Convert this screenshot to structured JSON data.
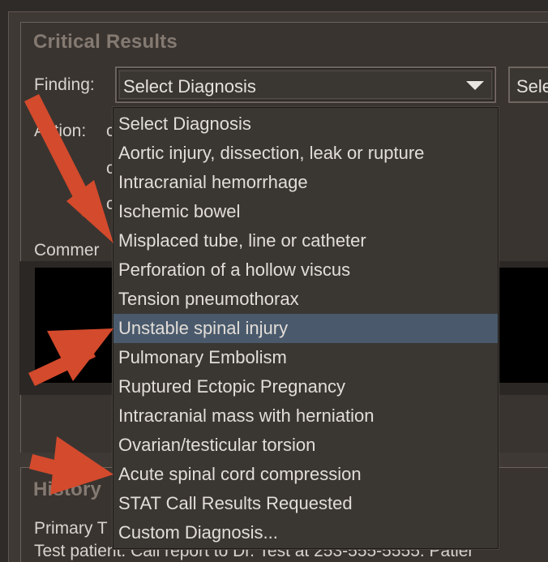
{
  "critical_results": {
    "title": "Critical Results",
    "finding_label": "Finding:",
    "finding_value": "Select Diagnosis",
    "second_select_value": "Sele",
    "action_label": "Action:",
    "action_stub_1": "c",
    "action_stub_2": "c",
    "action_stub_3": "c",
    "comment_label": "Commer"
  },
  "history": {
    "title": "History",
    "primary_label": "Primary T",
    "note": "Test patient. Call report to Dr. Test at 253-555-5555. Patier"
  },
  "dropdown": {
    "options": [
      "Select Diagnosis",
      "Aortic injury, dissection, leak or rupture",
      "Intracranial hemorrhage",
      "Ischemic bowel",
      "Misplaced tube, line or catheter",
      "Perforation of a hollow viscus",
      "Tension pneumothorax",
      "Unstable spinal injury",
      "Pulmonary Embolism",
      "Ruptured Ectopic Pregnancy",
      "Intracranial mass with herniation",
      "Ovarian/testicular torsion",
      "Acute spinal cord compression",
      "STAT Call Results Requested",
      "Custom Diagnosis..."
    ],
    "highlighted_option": "Unstable spinal injury"
  },
  "colors": {
    "annotation_arrow": "#d44a2c",
    "highlight": "#4a5a6c"
  }
}
